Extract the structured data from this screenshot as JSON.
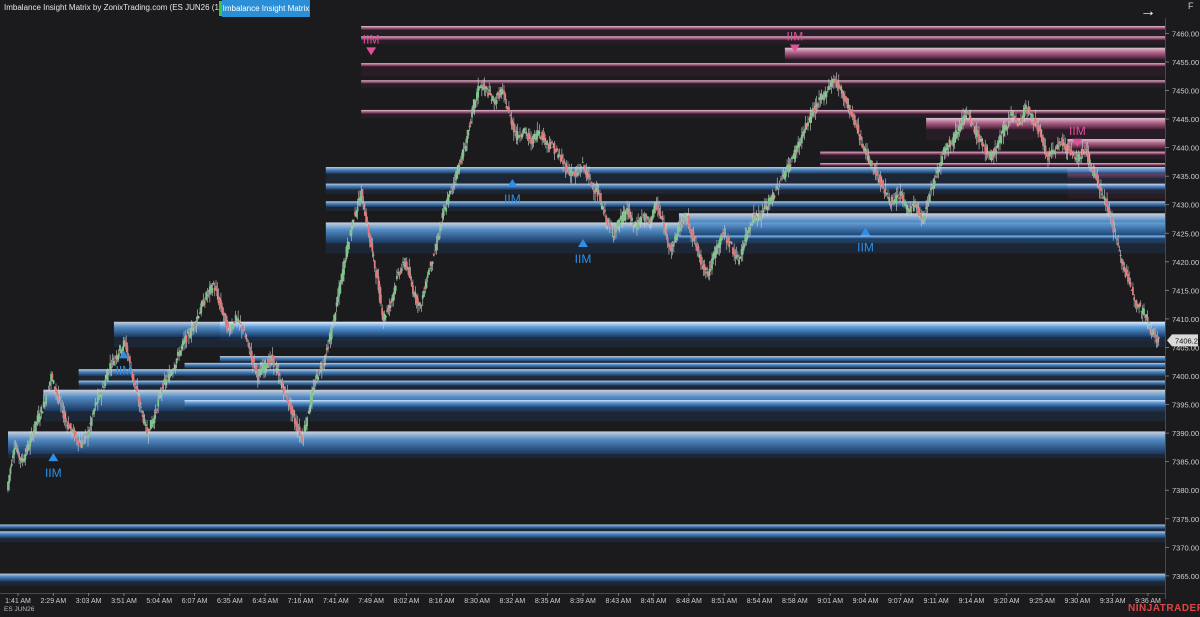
{
  "window": {
    "title": "Imbalance Insight Matrix by ZonixTrading.com (ES JUN26 (1000 Volume))",
    "indicator_tab": "Imbalance Insight Matrix",
    "indicator_marker_color": "#3ec43e",
    "nav_arrow_icon": "→",
    "side_label": "F"
  },
  "footer": {
    "symbol": "ES JUN26",
    "brand": "NINJATRADER"
  },
  "colors": {
    "background": "#1b1b1e",
    "bull_zone": "#2f80d6",
    "bear_zone": "#e060a8",
    "signal_bull": "#2f8fe6",
    "signal_bear": "#e0509a",
    "candle_up": "#7ec68a",
    "candle_down": "#e07a7a",
    "price_marker_bg": "#d9d9d9"
  },
  "chart_data": {
    "type": "candlestick",
    "instrument": "ES JUN26",
    "bar_type": "1000 Volume",
    "ylim": [
      7362,
      7462
    ],
    "y_ticks": [
      7365,
      7370,
      7375,
      7380,
      7385,
      7390,
      7395,
      7400,
      7405,
      7410,
      7415,
      7420,
      7425,
      7430,
      7435,
      7440,
      7445,
      7450,
      7455,
      7460
    ],
    "y_tick_labels": [
      "7365.00",
      "7370.00",
      "7375.00",
      "7380.00",
      "7385.00",
      "7390.00",
      "7395.00",
      "7400.00",
      "7405.00",
      "7410.00",
      "7415.00",
      "7420.00",
      "7425.00",
      "7430.00",
      "7435.00",
      "7440.00",
      "7445.00",
      "7450.00",
      "7455.00",
      "7460.00"
    ],
    "last_price": "7406.25",
    "x_labels": [
      "1:41 AM",
      "2:29 AM",
      "3:03 AM",
      "3:51 AM",
      "5:04 AM",
      "6:07 AM",
      "6:35 AM",
      "6:43 AM",
      "7:16 AM",
      "7:41 AM",
      "7:49 AM",
      "8:02 AM",
      "8:16 AM",
      "8:30 AM",
      "8:32 AM",
      "8:35 AM",
      "8:39 AM",
      "8:43 AM",
      "8:45 AM",
      "8:48 AM",
      "8:51 AM",
      "8:54 AM",
      "8:58 AM",
      "9:01 AM",
      "9:04 AM",
      "9:07 AM",
      "9:11 AM",
      "9:14 AM",
      "9:20 AM",
      "9:25 AM",
      "9:30 AM",
      "9:33 AM",
      "9:36 AM"
    ],
    "price_path": [
      [
        0,
        7380
      ],
      [
        1,
        7388
      ],
      [
        2,
        7385
      ],
      [
        3,
        7388
      ],
      [
        4,
        7392
      ],
      [
        5,
        7395
      ],
      [
        6,
        7400
      ],
      [
        7,
        7396
      ],
      [
        8,
        7392
      ],
      [
        9,
        7390
      ],
      [
        10,
        7388
      ],
      [
        11,
        7390
      ],
      [
        12,
        7395
      ],
      [
        13,
        7398
      ],
      [
        14,
        7402
      ],
      [
        15,
        7404
      ],
      [
        16,
        7406
      ],
      [
        17,
        7400
      ],
      [
        18,
        7395
      ],
      [
        19,
        7390
      ],
      [
        20,
        7393
      ],
      [
        21,
        7398
      ],
      [
        22,
        7400
      ],
      [
        23,
        7403
      ],
      [
        24,
        7406
      ],
      [
        25,
        7408
      ],
      [
        26,
        7411
      ],
      [
        27,
        7414
      ],
      [
        28,
        7416
      ],
      [
        29,
        7412
      ],
      [
        30,
        7408
      ],
      [
        31,
        7410
      ],
      [
        32,
        7408
      ],
      [
        33,
        7404
      ],
      [
        34,
        7400
      ],
      [
        35,
        7402
      ],
      [
        36,
        7403
      ],
      [
        37,
        7399
      ],
      [
        38,
        7396
      ],
      [
        39,
        7392
      ],
      [
        40,
        7389
      ],
      [
        41,
        7395
      ],
      [
        42,
        7400
      ],
      [
        43,
        7403
      ],
      [
        44,
        7408
      ],
      [
        45,
        7415
      ],
      [
        46,
        7422
      ],
      [
        47,
        7428
      ],
      [
        48,
        7432
      ],
      [
        49,
        7425
      ],
      [
        50,
        7418
      ],
      [
        51,
        7410
      ],
      [
        52,
        7413
      ],
      [
        53,
        7418
      ],
      [
        54,
        7420
      ],
      [
        55,
        7415
      ],
      [
        56,
        7412
      ],
      [
        57,
        7418
      ],
      [
        58,
        7422
      ],
      [
        59,
        7428
      ],
      [
        60,
        7432
      ],
      [
        61,
        7436
      ],
      [
        62,
        7440
      ],
      [
        63,
        7446
      ],
      [
        64,
        7451
      ],
      [
        65,
        7450
      ],
      [
        66,
        7448
      ],
      [
        67,
        7450
      ],
      [
        68,
        7446
      ],
      [
        69,
        7442
      ],
      [
        70,
        7443
      ],
      [
        71,
        7441
      ],
      [
        72,
        7443
      ],
      [
        73,
        7441
      ],
      [
        74,
        7440
      ],
      [
        75,
        7438
      ],
      [
        76,
        7436
      ],
      [
        77,
        7435
      ],
      [
        78,
        7437
      ],
      [
        79,
        7434
      ],
      [
        80,
        7432
      ],
      [
        81,
        7428
      ],
      [
        82,
        7425
      ],
      [
        83,
        7427
      ],
      [
        84,
        7429
      ],
      [
        85,
        7426
      ],
      [
        86,
        7428
      ],
      [
        87,
        7427
      ],
      [
        88,
        7430
      ],
      [
        89,
        7426
      ],
      [
        90,
        7422
      ],
      [
        91,
        7426
      ],
      [
        92,
        7428
      ],
      [
        93,
        7424
      ],
      [
        94,
        7420
      ],
      [
        95,
        7418
      ],
      [
        96,
        7422
      ],
      [
        97,
        7425
      ],
      [
        98,
        7423
      ],
      [
        99,
        7420
      ],
      [
        100,
        7424
      ],
      [
        101,
        7428
      ],
      [
        102,
        7428
      ],
      [
        103,
        7430
      ],
      [
        104,
        7432
      ],
      [
        105,
        7435
      ],
      [
        106,
        7437
      ],
      [
        107,
        7440
      ],
      [
        108,
        7443
      ],
      [
        109,
        7446
      ],
      [
        110,
        7448
      ],
      [
        111,
        7450
      ],
      [
        112,
        7452
      ],
      [
        113,
        7450
      ],
      [
        114,
        7447
      ],
      [
        115,
        7444
      ],
      [
        116,
        7440
      ],
      [
        117,
        7437
      ],
      [
        118,
        7435
      ],
      [
        119,
        7432
      ],
      [
        120,
        7430
      ],
      [
        121,
        7432
      ],
      [
        122,
        7429
      ],
      [
        123,
        7430
      ],
      [
        124,
        7427
      ],
      [
        125,
        7432
      ],
      [
        126,
        7436
      ],
      [
        127,
        7440
      ],
      [
        128,
        7441
      ],
      [
        129,
        7444
      ],
      [
        130,
        7446
      ],
      [
        131,
        7443
      ],
      [
        132,
        7441
      ],
      [
        133,
        7438
      ],
      [
        134,
        7440
      ],
      [
        135,
        7443
      ],
      [
        136,
        7446
      ],
      [
        137,
        7444
      ],
      [
        138,
        7447
      ],
      [
        139,
        7445
      ],
      [
        140,
        7442
      ],
      [
        141,
        7438
      ],
      [
        142,
        7440
      ],
      [
        143,
        7441
      ],
      [
        144,
        7439
      ],
      [
        145,
        7438
      ],
      [
        146,
        7440
      ],
      [
        147,
        7436
      ],
      [
        148,
        7433
      ],
      [
        149,
        7430
      ],
      [
        150,
        7425
      ],
      [
        151,
        7420
      ],
      [
        152,
        7416
      ],
      [
        153,
        7413
      ],
      [
        154,
        7411
      ],
      [
        155,
        7408
      ],
      [
        156,
        7406
      ]
    ],
    "zones": [
      {
        "side": "bear",
        "from": "7:49 AM",
        "top": 7461.3,
        "bottom": 7460.6
      },
      {
        "side": "bear",
        "from": "7:49 AM",
        "top": 7459.5,
        "bottom": 7458.8
      },
      {
        "side": "bear",
        "from": "8:58 AM",
        "top": 7457.5,
        "bottom": 7455.5
      },
      {
        "side": "bear",
        "from": "7:49 AM",
        "top": 7454.8,
        "bottom": 7454.2
      },
      {
        "side": "bear",
        "from": "7:49 AM",
        "top": 7451.8,
        "bottom": 7451.2
      },
      {
        "side": "bear",
        "from": "7:49 AM",
        "top": 7446.6,
        "bottom": 7445.9
      },
      {
        "side": "bear",
        "from": "9:11 AM",
        "top": 7445.2,
        "bottom": 7443.2
      },
      {
        "side": "bear",
        "from": "9:30 AM",
        "top": 7441.5,
        "bottom": 7439.8
      },
      {
        "side": "bear",
        "from": "9:30 AM",
        "top": 7436.3,
        "bottom": 7434.6
      },
      {
        "side": "bear",
        "from": "9:30 AM",
        "top": 7433.6,
        "bottom": 7432.8
      },
      {
        "side": "bear",
        "from": "9:01 AM",
        "top": 7439.3,
        "bottom": 7438.7
      },
      {
        "side": "bear",
        "from": "9:01 AM",
        "top": 7437.3,
        "bottom": 7436.8
      },
      {
        "side": "bull",
        "from": "7:41 AM",
        "top": 7436.6,
        "bottom": 7435.4
      },
      {
        "side": "bull",
        "from": "7:41 AM",
        "top": 7433.7,
        "bottom": 7432.6
      },
      {
        "side": "bull",
        "from": "7:41 AM",
        "top": 7430.6,
        "bottom": 7429.6
      },
      {
        "side": "bull",
        "from": "7:41 AM",
        "top": 7426.9,
        "bottom": 7423.2
      },
      {
        "side": "bull",
        "from": "8:48 AM",
        "top": 7428.5,
        "bottom": 7424.5
      },
      {
        "side": "bull",
        "from": "8:48 AM",
        "top": 7424.6,
        "bottom": 7424.0
      },
      {
        "side": "bull",
        "from": "3:51 AM",
        "top": 7409.5,
        "bottom": 7406.8
      },
      {
        "side": "bull",
        "from": "6:35 AM",
        "top": 7409.5,
        "bottom": 7406.8
      },
      {
        "side": "bull",
        "from": "6:35 AM",
        "top": 7403.5,
        "bottom": 7402.5
      },
      {
        "side": "bull",
        "from": "6:07 AM",
        "top": 7402.3,
        "bottom": 7401.4
      },
      {
        "side": "bull",
        "from": "3:03 AM",
        "top": 7401.2,
        "bottom": 7400.0
      },
      {
        "side": "bull",
        "from": "3:03 AM",
        "top": 7399.2,
        "bottom": 7398.3
      },
      {
        "side": "bull",
        "from": "2:29 AM",
        "top": 7397.6,
        "bottom": 7393.8
      },
      {
        "side": "bull",
        "from": "6:07 AM",
        "top": 7395.8,
        "bottom": 7394.4
      },
      {
        "side": "bull",
        "from": "1:41 AM",
        "top": 7390.3,
        "bottom": 7386.3
      },
      {
        "side": "bull",
        "from": "0:00",
        "top": 7374.0,
        "bottom": 7373.2
      },
      {
        "side": "bull",
        "from": "0:00",
        "top": 7372.8,
        "bottom": 7371.6
      },
      {
        "side": "bull",
        "from": "0:00",
        "top": 7365.4,
        "bottom": 7364.0
      }
    ],
    "signals": [
      {
        "label": "IIM",
        "side": "bull",
        "time": "2:29 AM",
        "price": 7386.5
      },
      {
        "label": "IIM",
        "side": "bull",
        "time": "3:51 AM",
        "price": 7404.5
      },
      {
        "label": "IIM",
        "side": "bull",
        "time": "8:32 AM",
        "price": 7434.5
      },
      {
        "label": "IIM",
        "side": "bull",
        "time": "8:39 AM",
        "price": 7424.0
      },
      {
        "label": "IIM",
        "side": "bull",
        "time": "9:04 AM",
        "price": 7426.0
      },
      {
        "label": "IIM",
        "side": "bear",
        "time": "7:49 AM",
        "price": 7456.5
      },
      {
        "label": "IIM",
        "side": "bear",
        "time": "8:58 AM",
        "price": 7457.0
      },
      {
        "label": "IIM",
        "side": "bear",
        "time": "9:30 AM",
        "price": 7440.5
      }
    ]
  }
}
